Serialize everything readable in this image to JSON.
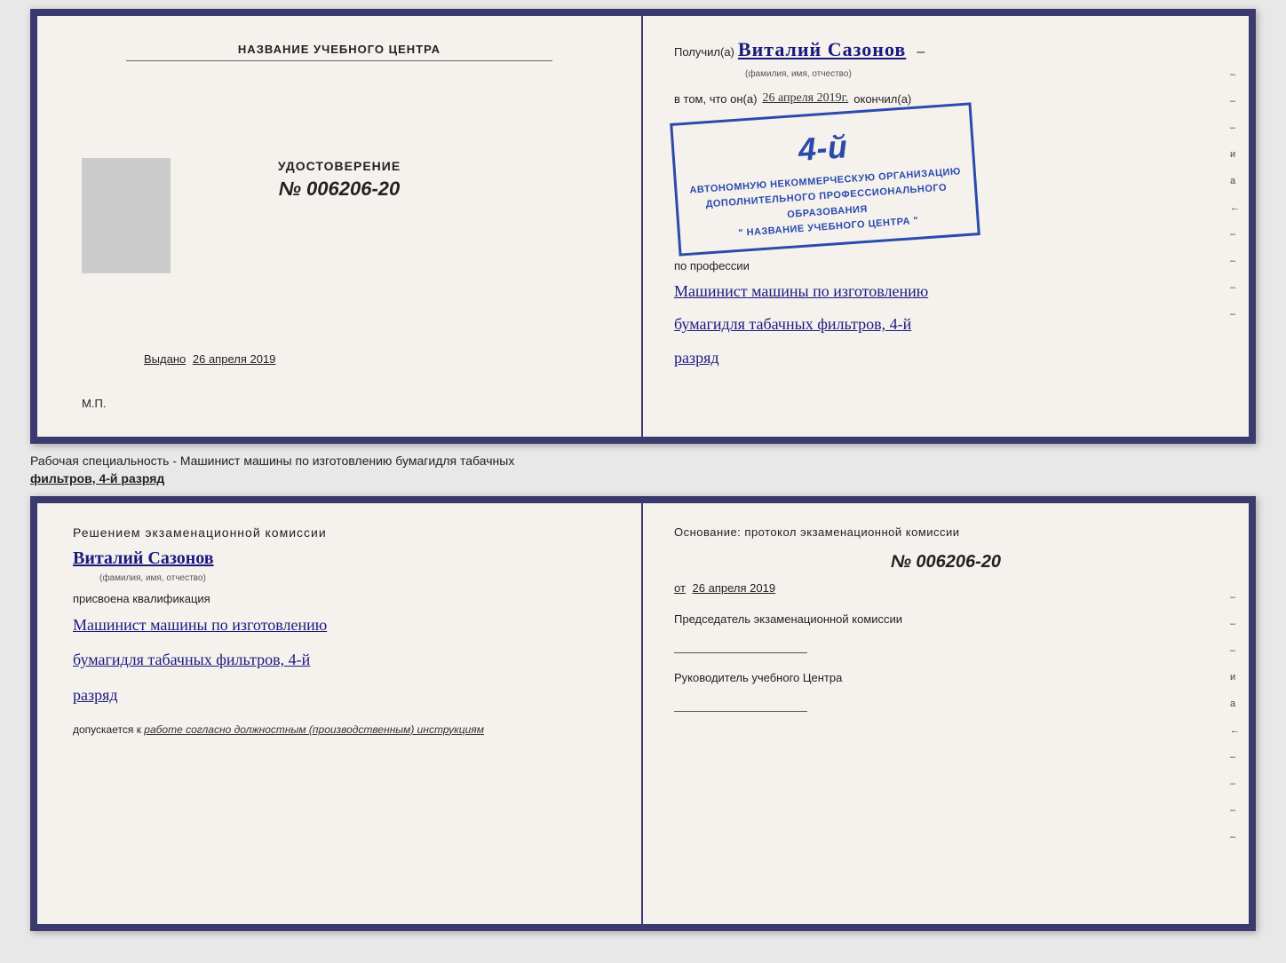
{
  "top_cert": {
    "left": {
      "title": "НАЗВАНИЕ УЧЕБНОГО ЦЕНТРА",
      "udostoverenie_label": "УДОСТОВЕРЕНИЕ",
      "number": "№ 006206-20",
      "vydano_label": "Выдано",
      "vydano_date": "26 апреля 2019",
      "mp": "М.П."
    },
    "right": {
      "poluchil_prefix": "Получил(а)",
      "name_handwritten": "Виталий Сазонов",
      "fio_label": "(фамилия, имя, отчество)",
      "dash": "–",
      "vtom_prefix": "в том, что он(а)",
      "date_handwritten": "26 апреля 2019г.",
      "okonchil": "окончил(а)",
      "stamp_line1": "АВТОНОМНУЮ НЕКОММЕРЧЕСКУЮ ОРГАНИЗАЦИЮ",
      "stamp_line2": "ДОПОЛНИТЕЛЬНОГО ПРОФЕССИОНАЛЬНОГО ОБРАЗОВАНИЯ",
      "stamp_line3": "\" НАЗВАНИЕ УЧЕБНОГО ЦЕНТРА \"",
      "stamp_number": "4-й",
      "po_professii": "по профессии",
      "profession_line1": "Машинист машины по изготовлению",
      "profession_line2": "бумагидля табачных фильтров, 4-й",
      "profession_line3": "разряд",
      "sidebar_marks": [
        "–",
        "–",
        "–",
        "и",
        "а",
        "←",
        "–",
        "–",
        "–",
        "–"
      ]
    }
  },
  "label_strip": {
    "text_prefix": "Рабочая специальность - Машинист машины по изготовлению бумагидля табачных",
    "text_underlined": "фильтров, 4-й разряд"
  },
  "bottom_cert": {
    "left": {
      "title": "Решением  экзаменационной  комиссии",
      "name_handwritten": "Виталий Сазонов",
      "fio_label": "(фамилия, имя, отчество)",
      "prisvoena": "присвоена квалификация",
      "profession_line1": "Машинист машины по изготовлению",
      "profession_line2": "бумагидля табачных фильтров, 4-й",
      "profession_line3": "разряд",
      "dopuskaetsya_label": "допускается к",
      "dopuskaetsya_text": "работе согласно должностным (производственным) инструкциям"
    },
    "right": {
      "osnovanie": "Основание:  протокол  экзаменационной  комиссии",
      "protocol_number": "№ 006206-20",
      "ot_label": "от",
      "ot_date": "26 апреля 2019",
      "predsedatel_label": "Председатель экзаменационной комиссии",
      "rukovoditel_label": "Руководитель учебного Центра",
      "sidebar_marks": [
        "–",
        "–",
        "–",
        "и",
        "а",
        "←",
        "–",
        "–",
        "–",
        "–"
      ]
    }
  }
}
